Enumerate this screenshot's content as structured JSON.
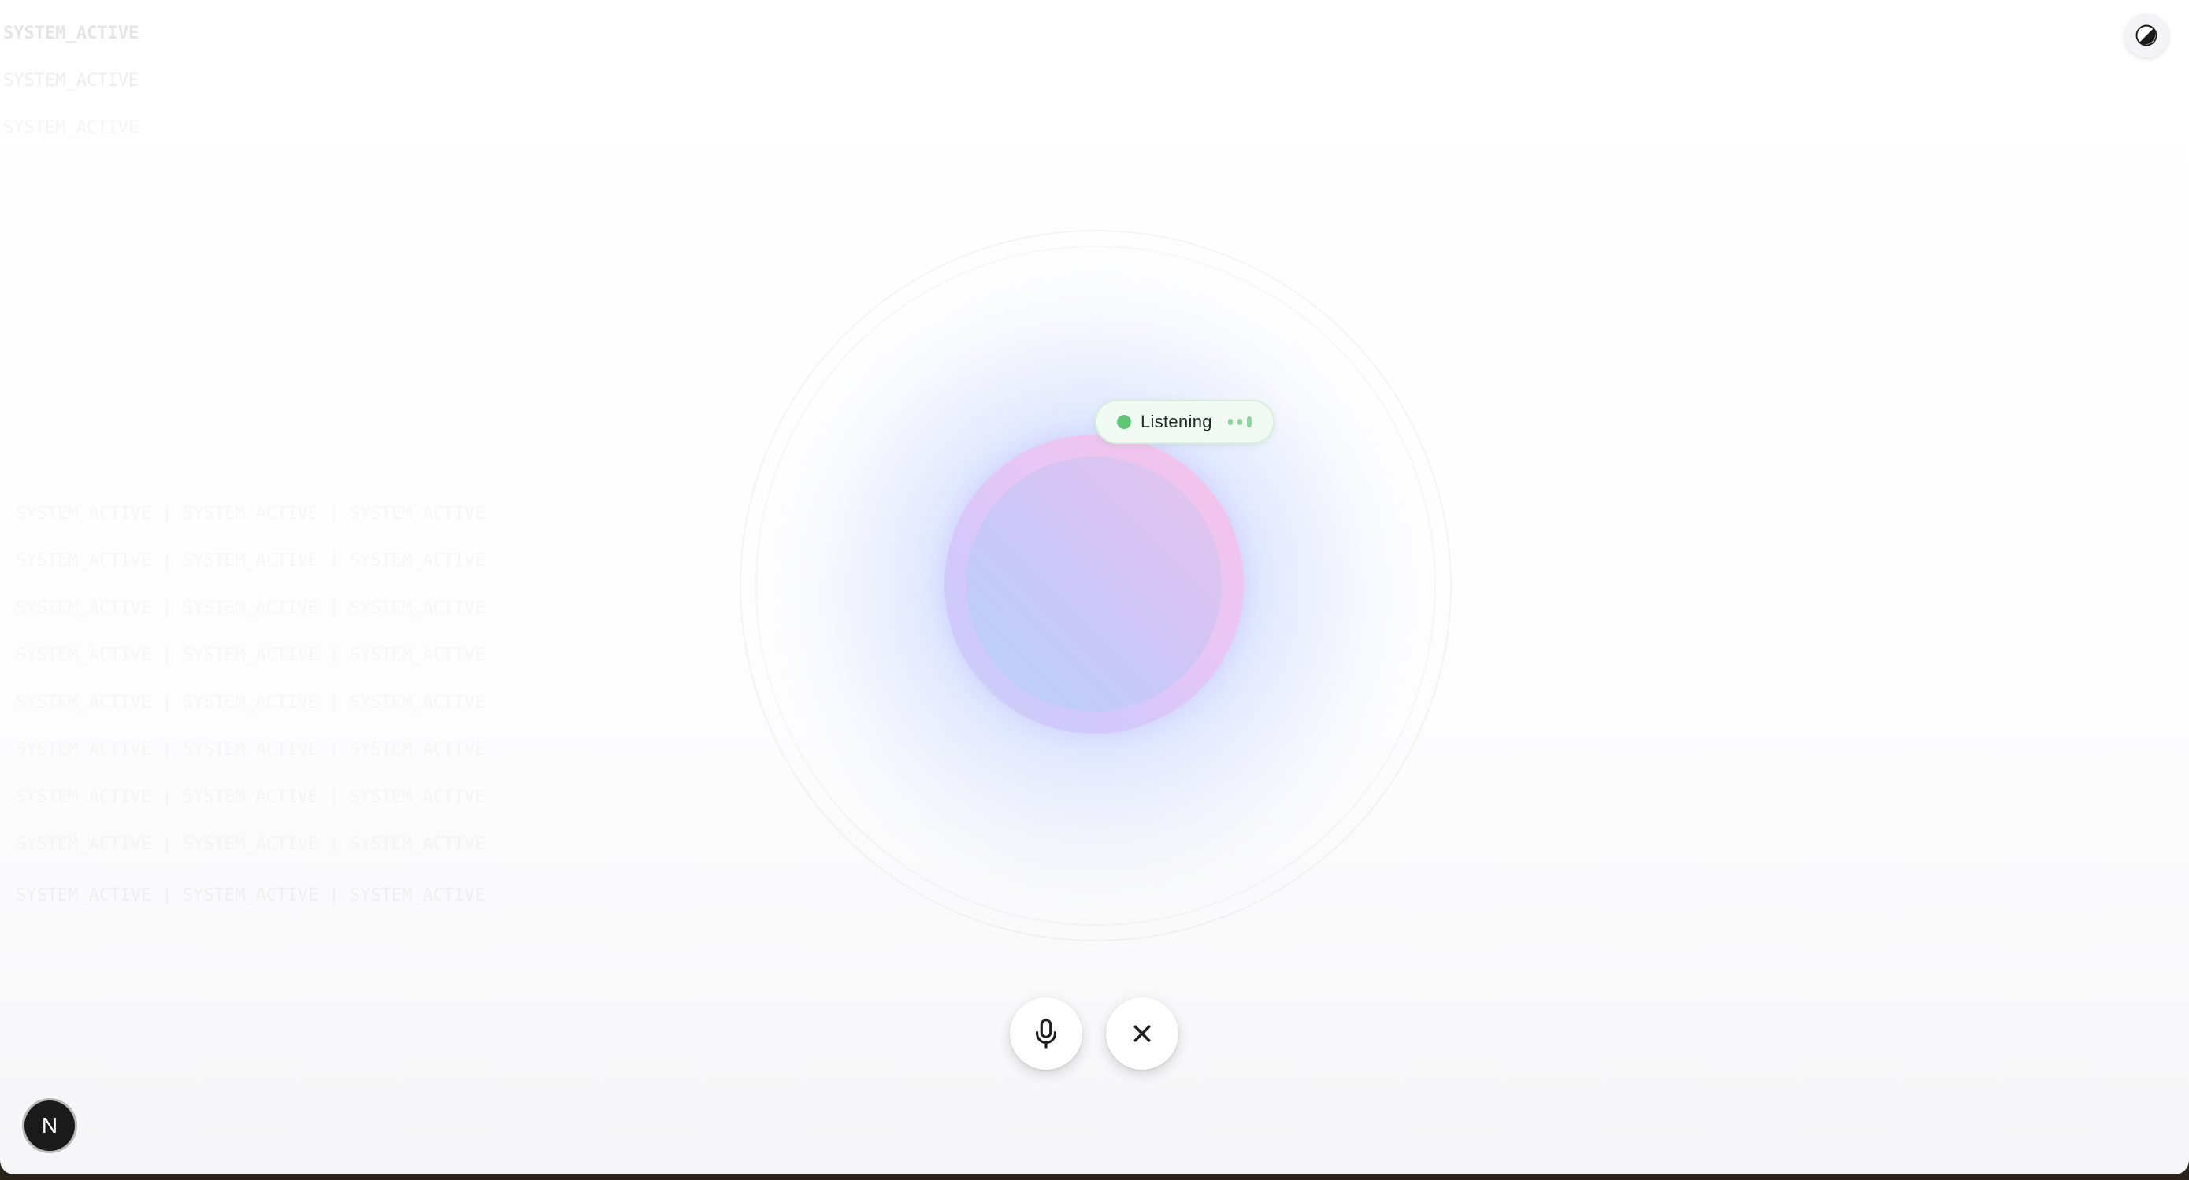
{
  "background_log": {
    "line1": "SYSTEM_ACTIVE",
    "line2": "SYSTEM_ACTIVE",
    "line3": "SYSTEM_ACTIVE",
    "row_text": "SYSTEM_ACTIVE | SYSTEM_ACTIVE | SYSTEM_ACTIVE"
  },
  "status": {
    "label": "Listening",
    "dot_color": "#5dc874",
    "wave_color": "#8ad79a"
  },
  "controls": {
    "mic_icon": "microphone-icon",
    "close_icon": "close-icon"
  },
  "theme_toggle": {
    "icon": "contrast-icon"
  },
  "dev_badge": {
    "letter": "N"
  },
  "colors": {
    "orb_pink": "#f7c3e6",
    "orb_blue": "#b7d2fa",
    "aura": "#a0b9ff"
  }
}
